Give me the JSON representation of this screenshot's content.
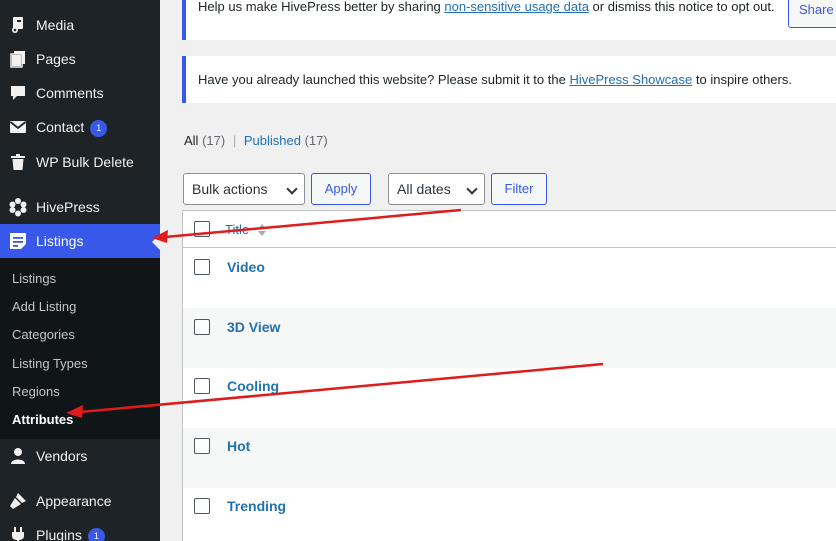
{
  "colors": {
    "sidebar": "#1d2327",
    "submenu": "#101517",
    "accent": "#3858e9",
    "link": "#2271b1",
    "annotation_arrow": "#e01b1b"
  },
  "sidebar": {
    "items": [
      {
        "label": "Media",
        "icon": "media-icon"
      },
      {
        "label": "Pages",
        "icon": "pages-icon"
      },
      {
        "label": "Comments",
        "icon": "comments-icon"
      },
      {
        "label": "Contact",
        "icon": "mail-icon",
        "badge": "1"
      },
      {
        "label": "WP Bulk Delete",
        "icon": "trash-icon"
      },
      {
        "label": "HivePress",
        "icon": "hivepress-icon"
      },
      {
        "label": "Listings",
        "icon": "listings-icon",
        "active": true
      },
      {
        "label": "Vendors",
        "icon": "vendors-icon"
      },
      {
        "label": "Appearance",
        "icon": "appearance-icon"
      },
      {
        "label": "Plugins",
        "icon": "plugins-icon",
        "badge": "1"
      }
    ],
    "submenu": [
      "Listings",
      "Add Listing",
      "Categories",
      "Listing Types",
      "Regions",
      "Attributes"
    ],
    "submenu_current": "Attributes"
  },
  "notices": {
    "usage": {
      "before": "Help us make HivePress better by sharing ",
      "link": "non-sensitive usage data",
      "after": " or dismiss this notice to opt out.",
      "button": "Share U"
    },
    "showcase": {
      "before": "Have you already launched this website? Please submit it to the ",
      "link": "HivePress Showcase",
      "after": " to inspire others."
    }
  },
  "views": {
    "all_label": "All",
    "all_count": "(17)",
    "separator": "|",
    "published_label": "Published",
    "published_count": "(17)"
  },
  "toolbar": {
    "bulk_actions": "Bulk actions",
    "apply": "Apply",
    "dates": "All dates",
    "filter": "Filter"
  },
  "table": {
    "header_title": "Title",
    "rows": [
      "Video",
      "3D View",
      "Cooling",
      "Hot",
      "Trending"
    ]
  }
}
